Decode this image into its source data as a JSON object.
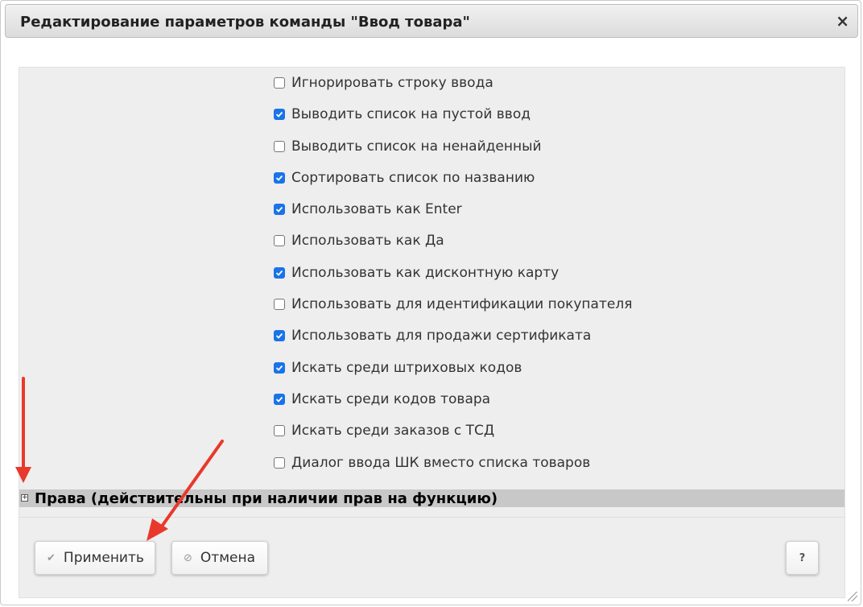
{
  "dialog": {
    "title": "Редактирование параметров команды \"Ввод товара\"",
    "close_glyph": "×"
  },
  "options": [
    {
      "label": "Игнорировать строку ввода",
      "checked": false
    },
    {
      "label": "Выводить список на пустой ввод",
      "checked": true
    },
    {
      "label": "Выводить список на ненайденный",
      "checked": false
    },
    {
      "label": "Сортировать список по названию",
      "checked": true
    },
    {
      "label": "Использовать как Enter",
      "checked": true
    },
    {
      "label": "Использовать как Да",
      "checked": false
    },
    {
      "label": "Использовать как дисконтную карту",
      "checked": true
    },
    {
      "label": "Использовать для идентификации покупателя",
      "checked": false
    },
    {
      "label": "Использовать для продажи сертификата",
      "checked": true
    },
    {
      "label": "Искать среди штриховых кодов",
      "checked": true
    },
    {
      "label": "Искать среди кодов товара",
      "checked": true
    },
    {
      "label": "Искать среди заказов с ТСД",
      "checked": false
    },
    {
      "label": "Диалог ввода ШК вместо списка товаров",
      "checked": false
    }
  ],
  "rights_section": {
    "title": "Права (действительны при наличии прав на функцию)",
    "expand_glyph": "+"
  },
  "footer": {
    "apply_label": "Применить",
    "apply_icon": "check-icon",
    "cancel_label": "Отмена",
    "cancel_icon": "ban-icon",
    "help_label": "?"
  },
  "colors": {
    "checkbox_checked": "#1a73e8",
    "annotation_arrow": "#e8392c",
    "section_bar": "#c8c8c8"
  }
}
